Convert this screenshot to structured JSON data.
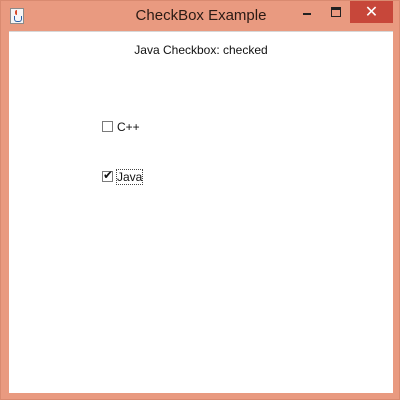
{
  "window": {
    "title": "CheckBox Example",
    "close_glyph": "✕",
    "accent_color": "#e99a80",
    "close_color": "#c7473a"
  },
  "content": {
    "status_text": "Java Checkbox: checked",
    "checkboxes": [
      {
        "label": "C++",
        "checked": false,
        "check_glyph": ""
      },
      {
        "label": "Java",
        "checked": true,
        "check_glyph": "✔",
        "focused": true
      }
    ]
  }
}
